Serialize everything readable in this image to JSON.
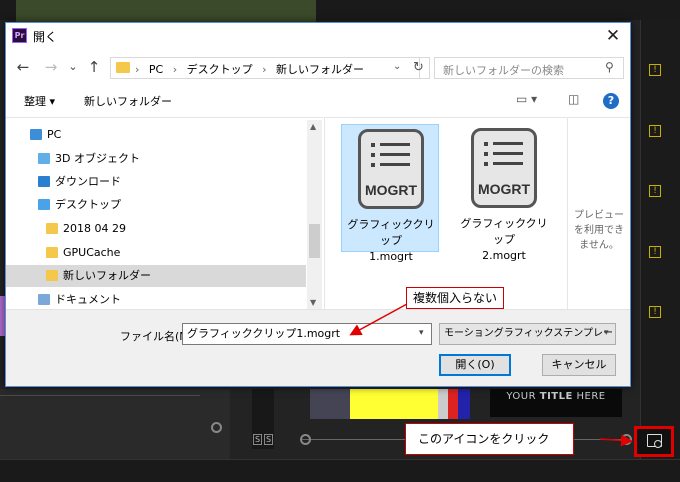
{
  "dialog": {
    "title": "開く",
    "app_icon_text": "Pr",
    "close_glyph": "✕"
  },
  "navigation": {
    "back": "←",
    "forward": "→",
    "recent": "⌄",
    "up": "↑",
    "breadcrumbs": [
      "PC",
      "デスクトップ",
      "新しいフォルダー"
    ],
    "refresh": "↻",
    "search_placeholder": "新しいフォルダーの検索"
  },
  "toolbar": {
    "organize": "整理 ▾",
    "new_folder": "新しいフォルダー",
    "help": "?"
  },
  "tree": {
    "items": [
      {
        "label": "PC",
        "icon": "pc-icon",
        "sel": false
      },
      {
        "label": "3D オブジェクト",
        "icon": "3d-objects-icon",
        "sel": false
      },
      {
        "label": "ダウンロード",
        "icon": "downloads-icon",
        "sel": false
      },
      {
        "label": "デスクトップ",
        "icon": "desktop-icon",
        "sel": false
      },
      {
        "label": "2018 04 29",
        "icon": "folder-icon",
        "sel": false
      },
      {
        "label": "GPUCache",
        "icon": "folder-icon",
        "sel": false
      },
      {
        "label": "新しいフォルダー",
        "icon": "folder-icon",
        "sel": true
      },
      {
        "label": "ドキュメント",
        "icon": "documents-icon",
        "sel": false
      }
    ]
  },
  "files": {
    "items": [
      {
        "name_line1": "グラフィッククリップ",
        "name_line2": "1.mogrt",
        "icon_label": "MOGRT",
        "selected": true
      },
      {
        "name_line1": "グラフィッククリップ",
        "name_line2": "2.mogrt",
        "icon_label": "MOGRT",
        "selected": false
      }
    ],
    "preview_note": "プレビューを利用できません。"
  },
  "bottom": {
    "filename_label": "ファイル名(N):",
    "filename_value": "グラフィッククリップ1.mogrt",
    "filetype_value": "モーショングラフィックステンプレート (*.",
    "open_button": "開く(O)",
    "cancel_button": "キャンセル"
  },
  "annotations": {
    "callout_top": "複数個入らない",
    "callout_bottom": "このアイコンをクリック"
  },
  "background": {
    "title_text_plain": "YOUR ",
    "title_text_bold": "TITLE",
    "title_text_rest": " HERE",
    "solo_label": "S"
  },
  "colors": {
    "dialog_border": "#5a8fd6",
    "accent_blue": "#0078d7",
    "annotation_red": "#e00000",
    "selection": "#cce8ff"
  }
}
